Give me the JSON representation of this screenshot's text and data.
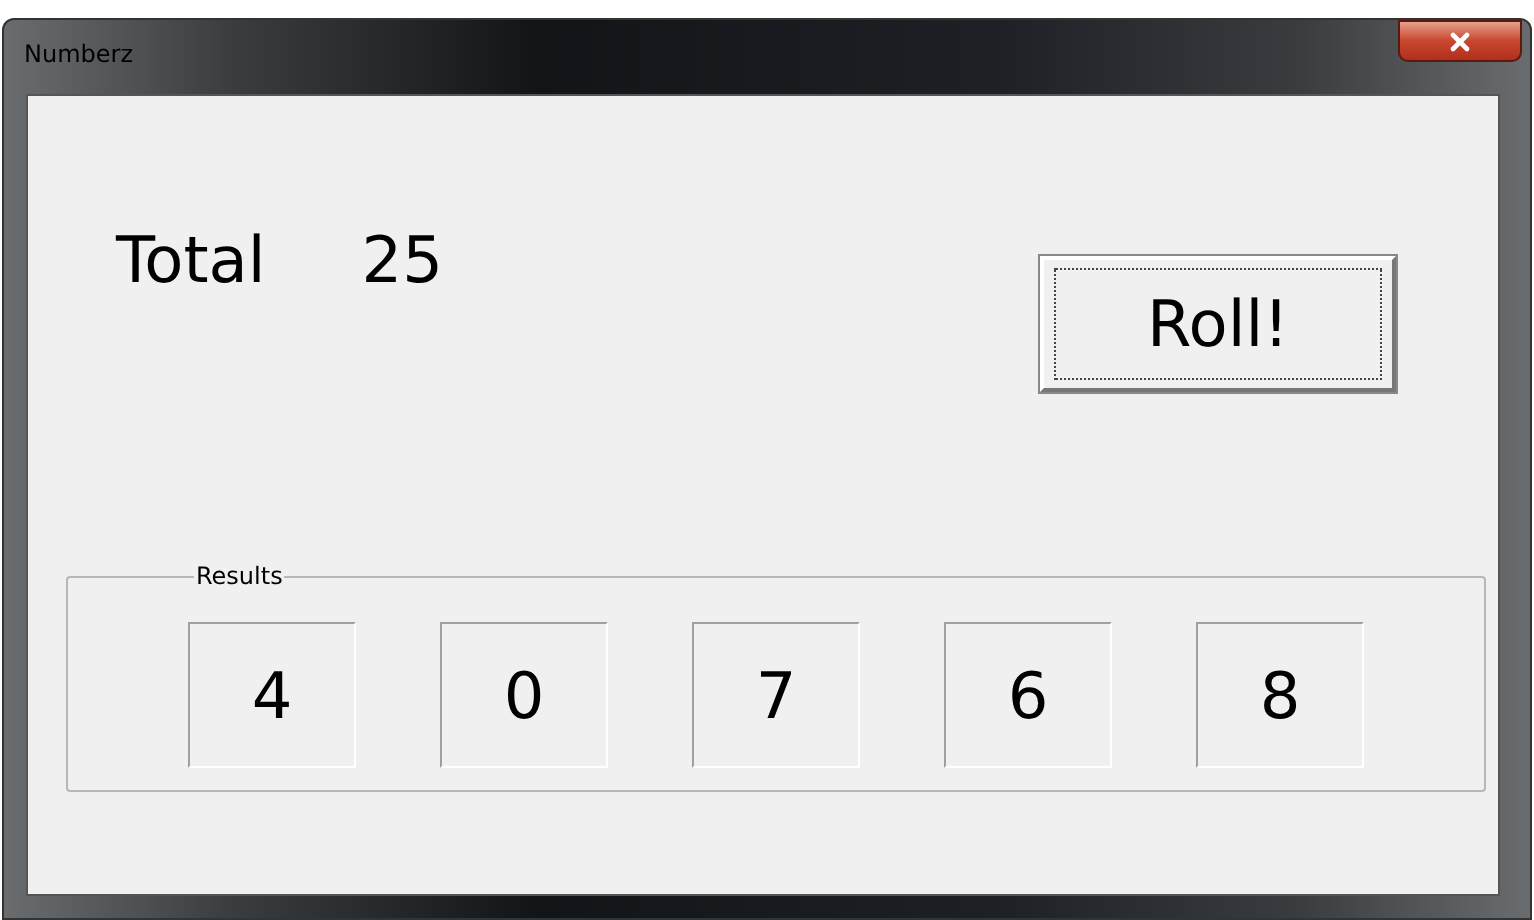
{
  "window": {
    "title": "Numberz"
  },
  "total": {
    "label": "Total",
    "value": "25"
  },
  "roll_button": {
    "label": "Roll!"
  },
  "results": {
    "legend": "Results",
    "values": [
      "4",
      "0",
      "7",
      "6",
      "8"
    ]
  }
}
